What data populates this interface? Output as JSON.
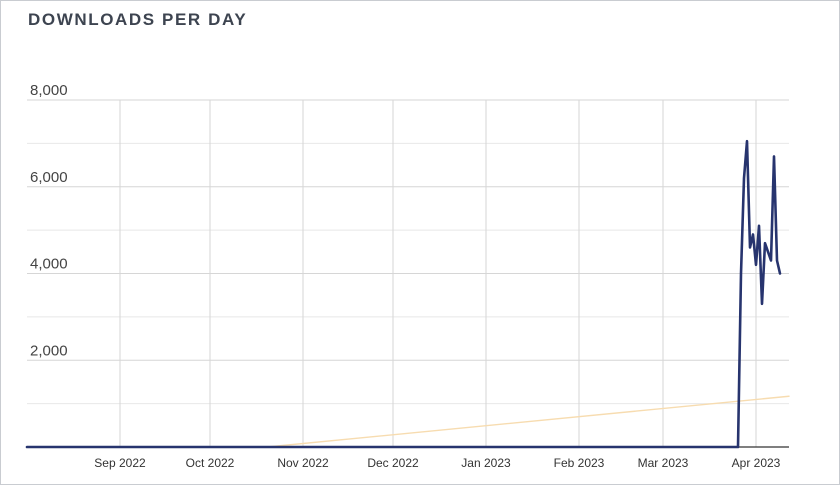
{
  "chart_data": {
    "type": "line",
    "title": "DOWNLOADS PER DAY",
    "xlabel": "",
    "ylabel": "",
    "ylim": [
      0,
      8000
    ],
    "ytick_labels": [
      "8,000",
      "6,000",
      "4,000",
      "2,000"
    ],
    "ytick_values": [
      8000,
      6000,
      4000,
      2000
    ],
    "xtick_labels": [
      "Sep 2022",
      "Oct 2022",
      "Nov 2022",
      "Dec 2022",
      "Jan 2023",
      "Feb 2023",
      "Mar 2023",
      "Apr 2023"
    ],
    "xtick_dates": [
      "2022-09-01",
      "2022-10-01",
      "2022-11-01",
      "2022-12-01",
      "2023-01-01",
      "2023-02-01",
      "2023-03-01",
      "2023-04-01"
    ],
    "xlim": [
      "2022-08-01",
      "2023-04-12"
    ],
    "grid": true,
    "series": [
      {
        "color": "#27346e",
        "points": [
          [
            "2022-08-01",
            0
          ],
          [
            "2022-09-01",
            0
          ],
          [
            "2022-10-01",
            0
          ],
          [
            "2022-11-01",
            0
          ],
          [
            "2022-12-01",
            0
          ],
          [
            "2023-01-01",
            0
          ],
          [
            "2023-02-01",
            0
          ],
          [
            "2023-03-01",
            0
          ],
          [
            "2023-03-26",
            0
          ],
          [
            "2023-03-27",
            4000
          ],
          [
            "2023-03-28",
            6200
          ],
          [
            "2023-03-29",
            7050
          ],
          [
            "2023-03-30",
            4600
          ],
          [
            "2023-03-31",
            4900
          ],
          [
            "2023-04-01",
            4200
          ],
          [
            "2023-04-02",
            5100
          ],
          [
            "2023-04-03",
            3300
          ],
          [
            "2023-04-04",
            4700
          ],
          [
            "2023-04-05",
            4500
          ],
          [
            "2023-04-06",
            4300
          ],
          [
            "2023-04-07",
            6700
          ],
          [
            "2023-04-08",
            4300
          ],
          [
            "2023-04-09",
            4000
          ]
        ]
      },
      {
        "color": "#f7dcb0",
        "points": [
          [
            "2022-10-20",
            0
          ],
          [
            "2023-04-12",
            1170
          ]
        ]
      }
    ]
  }
}
